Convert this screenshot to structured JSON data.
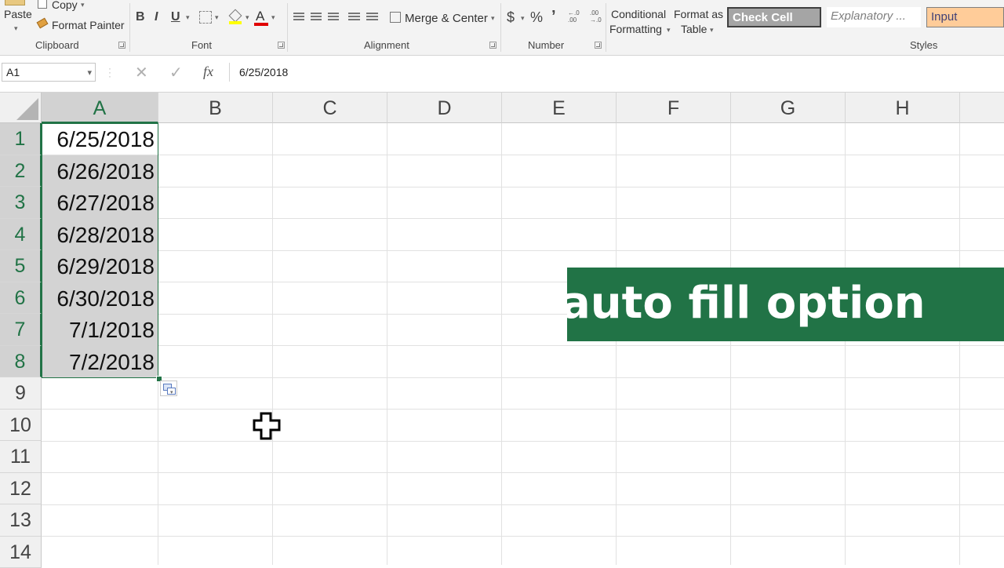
{
  "ribbon": {
    "clipboard": {
      "paste_label": "Paste",
      "copy_label": "Copy",
      "format_painter_label": "Format Painter",
      "group_label": "Clipboard"
    },
    "font": {
      "bold": "B",
      "italic": "I",
      "underline": "U",
      "font_color_glyph": "A",
      "group_label": "Font"
    },
    "alignment": {
      "merge_center_label": "Merge & Center",
      "group_label": "Alignment"
    },
    "number": {
      "currency": "$",
      "percent": "%",
      "comma": "’",
      "group_label": "Number"
    },
    "styles": {
      "conditional_formatting_line1": "Conditional",
      "conditional_formatting_line2": "Formatting",
      "format_as_table_line1": "Format as",
      "format_as_table_line2": "Table",
      "check_cell": "Check Cell",
      "explanatory": "Explanatory ...",
      "input": "Input",
      "group_label": "Styles"
    }
  },
  "formula_bar": {
    "name_box": "A1",
    "fx": "fx",
    "value": "6/25/2018"
  },
  "grid": {
    "columns": [
      "A",
      "B",
      "C",
      "D",
      "E",
      "F",
      "G",
      "H"
    ],
    "rows": [
      "1",
      "2",
      "3",
      "4",
      "5",
      "6",
      "7",
      "8",
      "9",
      "10",
      "11",
      "12",
      "13",
      "14"
    ],
    "column_a_values": [
      "6/25/2018",
      "6/26/2018",
      "6/27/2018",
      "6/28/2018",
      "6/29/2018",
      "6/30/2018",
      "7/1/2018",
      "7/2/2018"
    ]
  },
  "overlay": {
    "banner_text": "auto fill option"
  },
  "colors": {
    "excel_green": "#217346",
    "selection_fill": "#d3d3d3",
    "check_cell_bg": "#a5a5a5",
    "input_bg": "#ffcc99",
    "input_text": "#3f3f76"
  }
}
